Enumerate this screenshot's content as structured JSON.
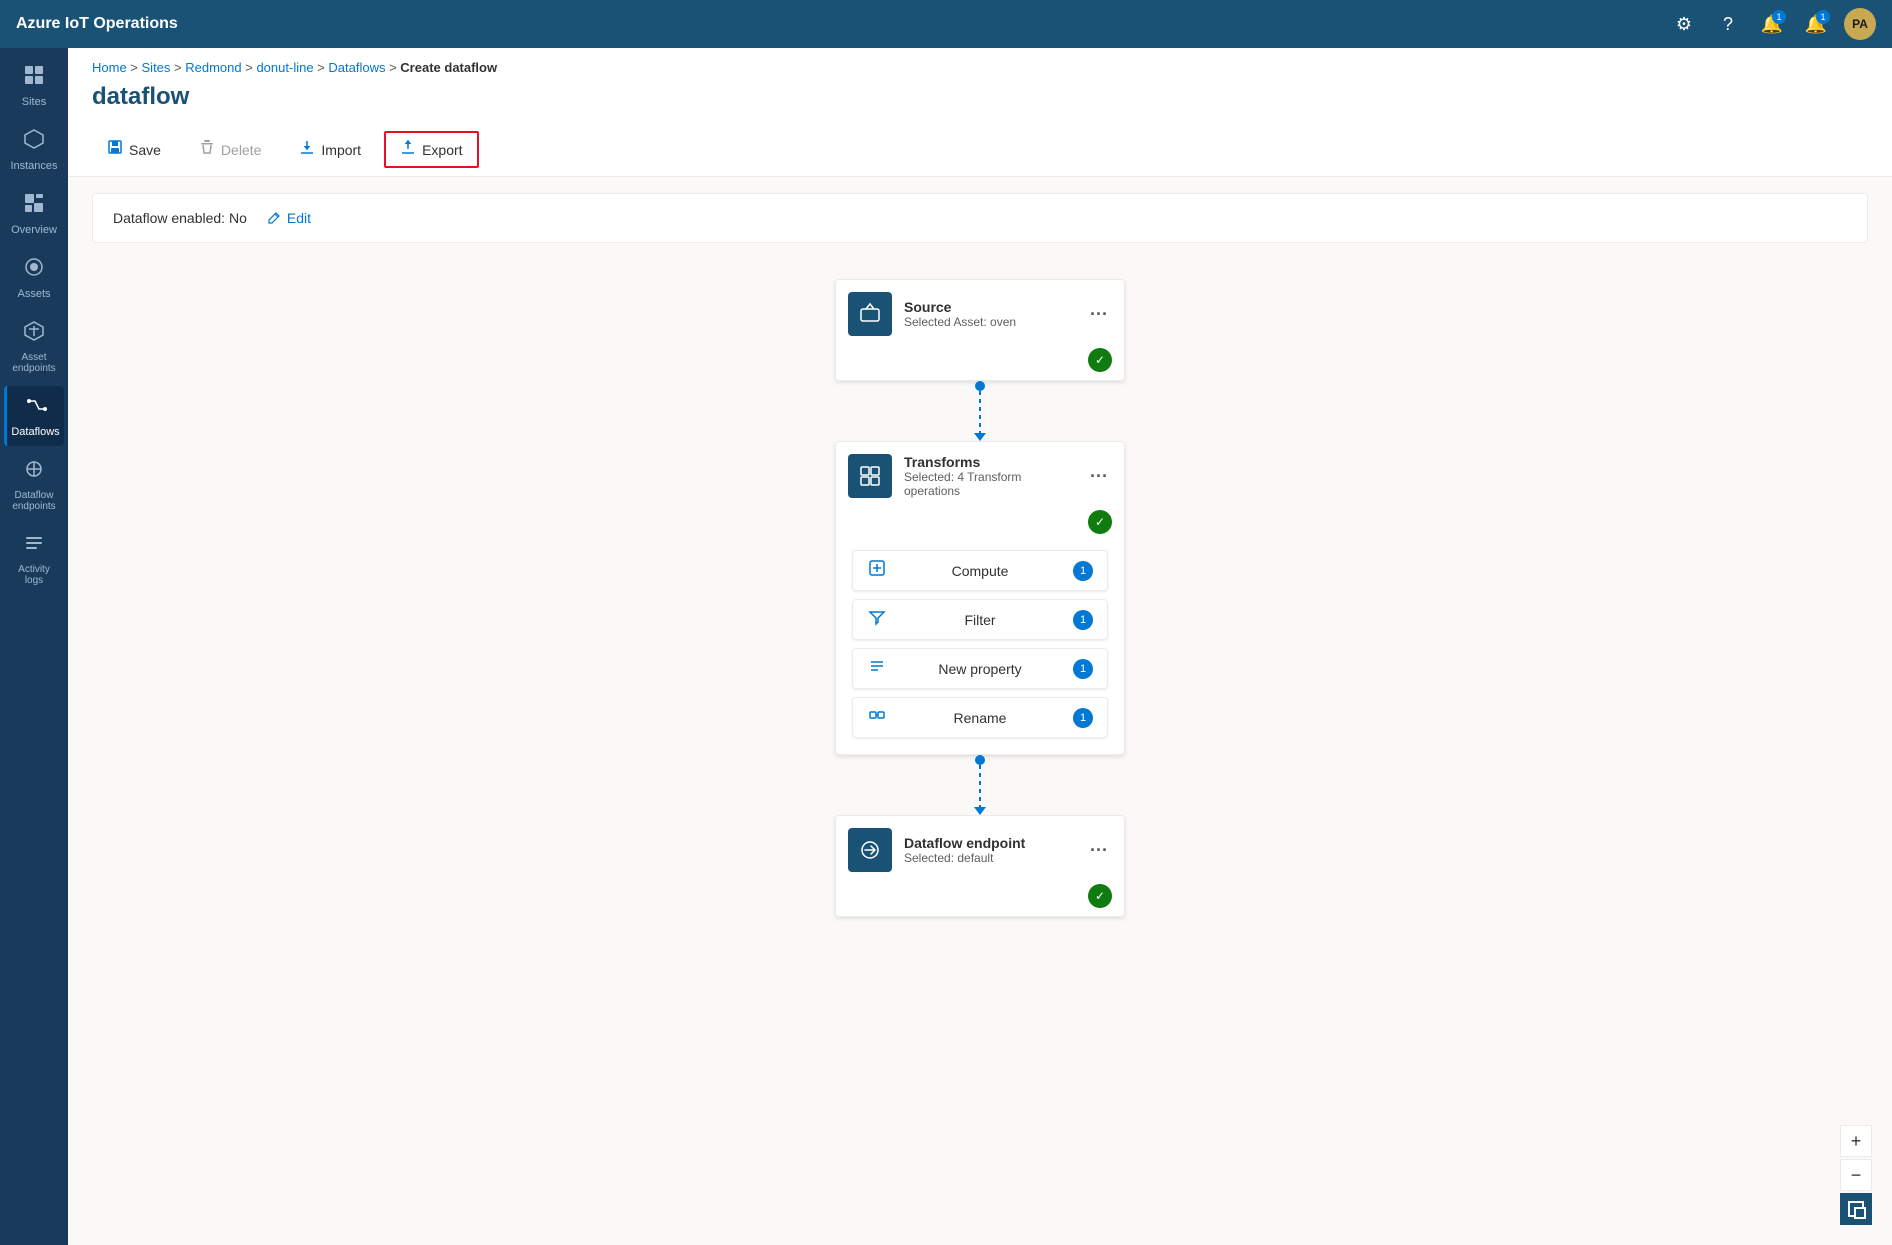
{
  "app": {
    "title": "Azure IoT Operations"
  },
  "topbar": {
    "icons": [
      "⚙",
      "?",
      "🔔",
      "🔔"
    ],
    "notifications": [
      null,
      null,
      "1",
      "1"
    ],
    "avatar": "PA"
  },
  "sidebar": {
    "items": [
      {
        "id": "sites",
        "label": "Sites",
        "icon": "⊞"
      },
      {
        "id": "instances",
        "label": "Instances",
        "icon": "⬡"
      },
      {
        "id": "overview",
        "label": "Overview",
        "icon": "▦"
      },
      {
        "id": "assets",
        "label": "Assets",
        "icon": "◈"
      },
      {
        "id": "asset-endpoints",
        "label": "Asset endpoints",
        "icon": "⬡"
      },
      {
        "id": "dataflows",
        "label": "Dataflows",
        "icon": "⇌",
        "active": true
      },
      {
        "id": "dataflow-endpoints",
        "label": "Dataflow endpoints",
        "icon": "⊕"
      },
      {
        "id": "activity-logs",
        "label": "Activity logs",
        "icon": "≡"
      }
    ]
  },
  "breadcrumb": {
    "items": [
      "Home",
      "Sites",
      "Redmond",
      "donut-line",
      "Dataflows"
    ],
    "current": "Create dataflow"
  },
  "page": {
    "title": "dataflow"
  },
  "toolbar": {
    "buttons": [
      {
        "id": "save",
        "label": "Save",
        "icon": "💾",
        "disabled": false,
        "active": false
      },
      {
        "id": "delete",
        "label": "Delete",
        "icon": "🗑",
        "disabled": true,
        "active": false
      },
      {
        "id": "import",
        "label": "Import",
        "icon": "↓",
        "disabled": false,
        "active": false
      },
      {
        "id": "export",
        "label": "Export",
        "icon": "↑",
        "disabled": false,
        "active": true
      }
    ]
  },
  "dataflow": {
    "enabled_label": "Dataflow enabled: No",
    "edit_label": "Edit",
    "nodes": [
      {
        "id": "source",
        "title": "Source",
        "subtitle": "Selected Asset: oven",
        "icon": "📦",
        "has_check": true
      },
      {
        "id": "transforms",
        "title": "Transforms",
        "subtitle": "Selected: 4 Transform operations",
        "icon": "⊞",
        "has_check": true,
        "operations": [
          {
            "id": "compute",
            "label": "Compute",
            "icon": "⊡",
            "count": 1
          },
          {
            "id": "filter",
            "label": "Filter",
            "icon": "⇌",
            "count": 1
          },
          {
            "id": "new-property",
            "label": "New property",
            "icon": "≡",
            "count": 1
          },
          {
            "id": "rename",
            "label": "Rename",
            "icon": "⊟",
            "count": 1
          }
        ]
      },
      {
        "id": "dataflow-endpoint",
        "title": "Dataflow endpoint",
        "subtitle": "Selected: default",
        "icon": "⇌",
        "has_check": true
      }
    ]
  }
}
